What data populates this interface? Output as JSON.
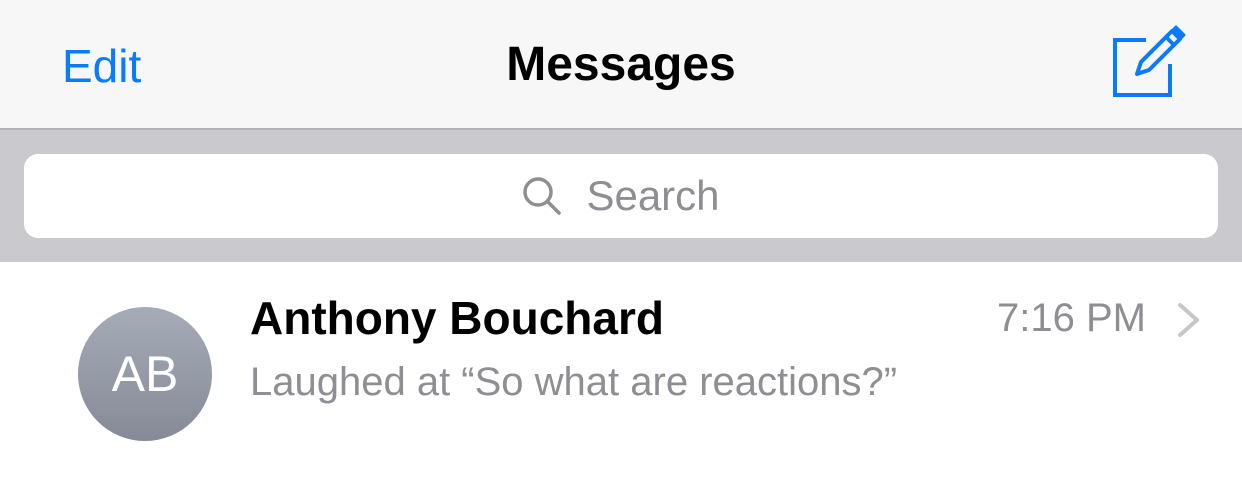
{
  "nav": {
    "edit_label": "Edit",
    "title": "Messages",
    "compose_icon": "compose-icon",
    "accent_color": "#0a7aff"
  },
  "search": {
    "placeholder": "Search",
    "icon": "search-icon"
  },
  "conversations": [
    {
      "initials": "AB",
      "name": "Anthony Bouchard",
      "time": "7:16 PM",
      "preview": "Laughed at “So what are reactions?”",
      "chevron_icon": "chevron-right-icon"
    }
  ]
}
